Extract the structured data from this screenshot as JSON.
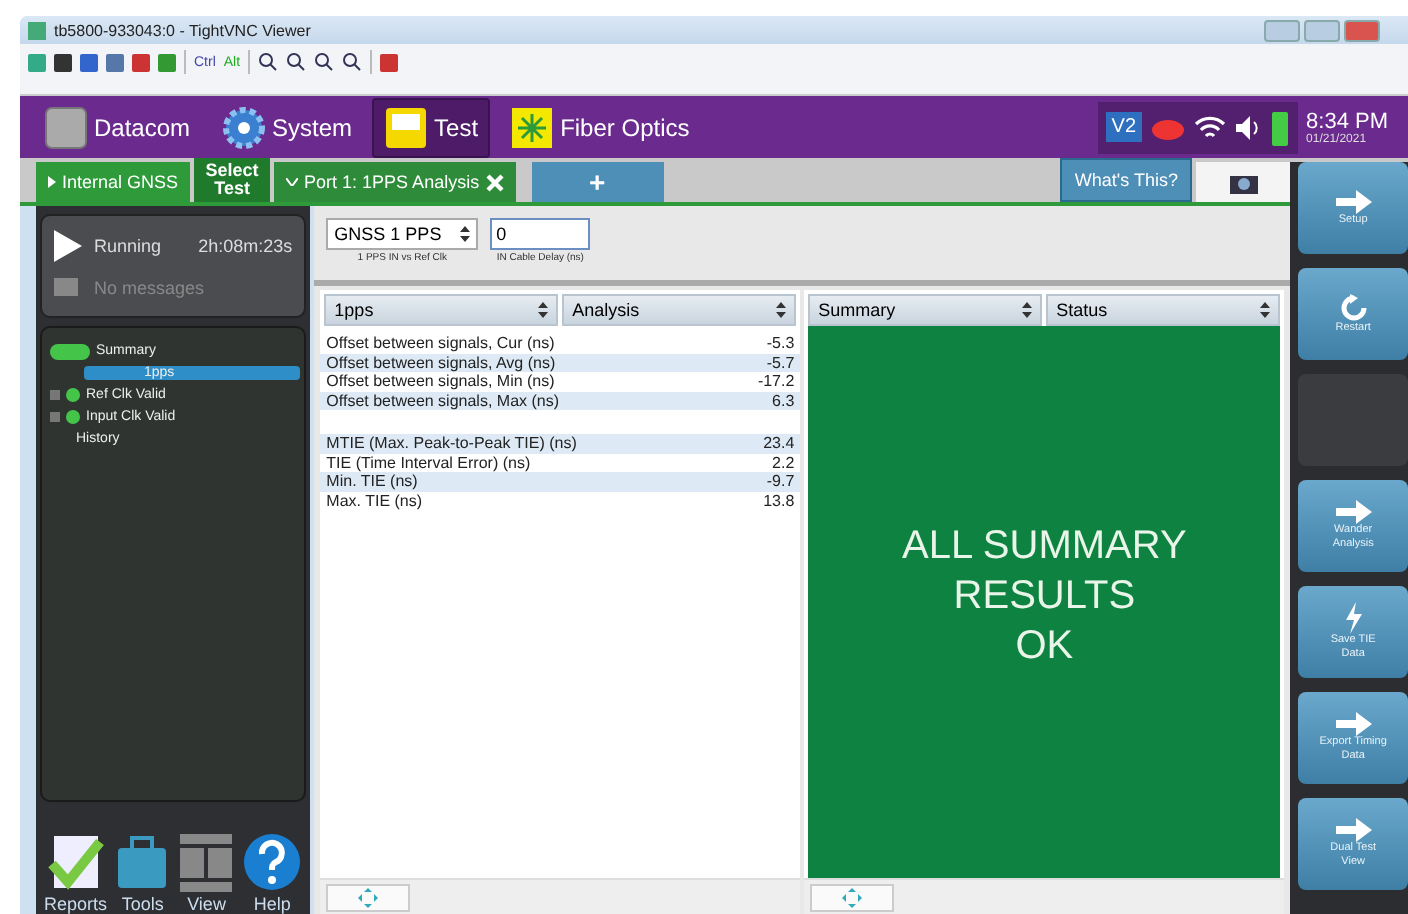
{
  "window": {
    "title": "tb5800-933043:0 - TightVNC Viewer"
  },
  "toolbar": {
    "keys": [
      "Ctrl",
      "Alt"
    ]
  },
  "nav": {
    "items": [
      {
        "label": "Datacom",
        "kind": "device",
        "selected": false
      },
      {
        "label": "System",
        "kind": "gear",
        "selected": false
      },
      {
        "label": "Test",
        "kind": "bert",
        "selected": true
      },
      {
        "label": "Fiber Optics",
        "kind": "laser",
        "selected": false
      }
    ],
    "badge": "V2",
    "time": "8:34 PM",
    "date": "01/21/2021"
  },
  "tabs": {
    "items": [
      {
        "label": "Internal GNSS",
        "kind": "expander",
        "selected": false
      },
      {
        "label": "Select Test",
        "kind": "select",
        "selected": false
      },
      {
        "label": "Port 1: 1PPS Analysis",
        "kind": "port",
        "selected": true
      },
      {
        "label": "+",
        "kind": "add",
        "selected": false
      }
    ],
    "help": "What's This?"
  },
  "status": {
    "state": "Running",
    "elapsed": "2h:08m:23s",
    "messages": "No messages"
  },
  "tree": [
    {
      "label": "Summary",
      "kind": "pill",
      "selected": false,
      "children": [
        {
          "label": "1pps",
          "kind": "plain",
          "selected": true
        }
      ]
    },
    {
      "label": "Ref Clk Valid",
      "kind": "dot",
      "selected": false
    },
    {
      "label": "Input Clk Valid",
      "kind": "dot",
      "selected": false
    },
    {
      "label": "History",
      "kind": "plain",
      "selected": false
    }
  ],
  "bottom_buttons": [
    {
      "label": "Reports",
      "kind": "reports"
    },
    {
      "label": "Tools",
      "kind": "tools"
    },
    {
      "label": "View",
      "kind": "view"
    },
    {
      "label": "Help",
      "kind": "help"
    }
  ],
  "source": {
    "value": "GNSS 1 PPS",
    "caption": "1 PPS IN vs Ref Clk"
  },
  "delay": {
    "value": "0",
    "caption": "IN Cable Delay (ns)"
  },
  "table": {
    "columns": [
      "1pps",
      "Analysis"
    ],
    "rows": [
      {
        "label": "Offset between signals, Cur (ns)",
        "value": "-5.3",
        "kind": "row"
      },
      {
        "label": "Offset between signals, Avg (ns)",
        "value": "-5.7",
        "kind": "row"
      },
      {
        "label": "Offset between signals, Min (ns)",
        "value": "-17.2",
        "kind": "row"
      },
      {
        "label": "Offset between signals, Max (ns)",
        "value": "6.3",
        "kind": "row"
      },
      {
        "kind": "spacer"
      },
      {
        "label": "MTIE (Max. Peak-to-Peak TIE) (ns)",
        "value": "23.4",
        "kind": "row"
      },
      {
        "label": "TIE (Time Interval Error) (ns)",
        "value": "2.2",
        "kind": "row"
      },
      {
        "label": "Min. TIE (ns)",
        "value": "-9.7",
        "kind": "row"
      },
      {
        "label": "Max. TIE (ns)",
        "value": "13.8",
        "kind": "row"
      }
    ]
  },
  "summary": {
    "columns": [
      "Summary",
      "Status"
    ],
    "message": [
      "ALL SUMMARY",
      "RESULTS",
      "OK"
    ]
  },
  "side_buttons": [
    {
      "label": "Setup",
      "kind": "arrow"
    },
    {
      "label": "Restart",
      "kind": "restart"
    },
    {
      "kind": "empty"
    },
    {
      "label": "Wander Analysis",
      "kind": "arrow"
    },
    {
      "label": "Save TIE Data",
      "kind": "bolt"
    },
    {
      "label": "Export Timing Data",
      "kind": "arrow"
    },
    {
      "label": "Dual Test View",
      "kind": "arrow"
    }
  ]
}
